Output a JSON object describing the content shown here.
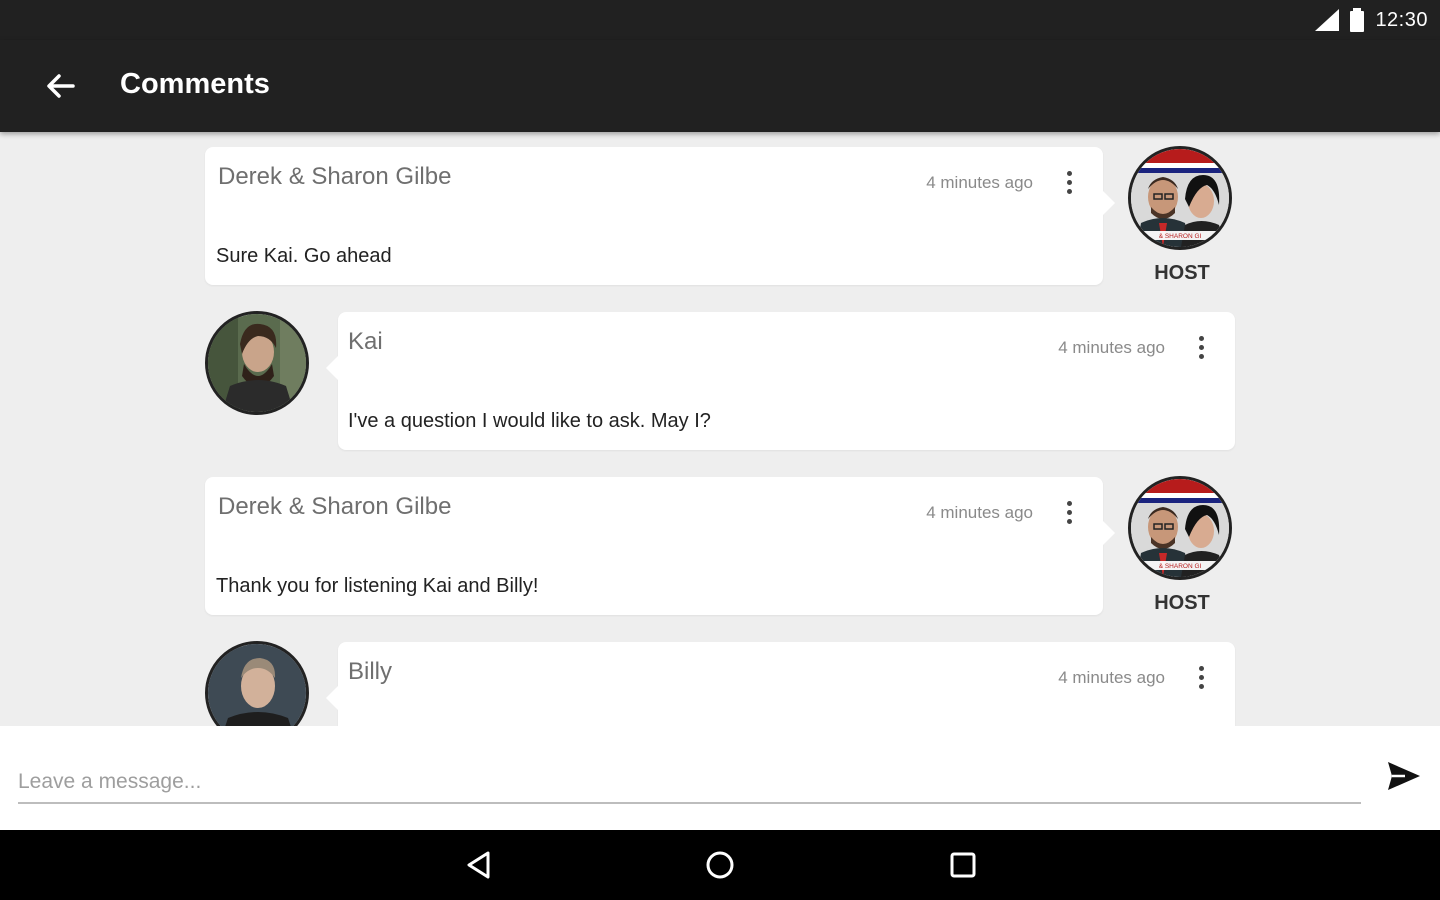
{
  "status_bar": {
    "time": "12:30",
    "icons": [
      "signal-icon",
      "battery-icon"
    ]
  },
  "app_bar": {
    "title": "Comments",
    "back_icon": "arrow-back-icon"
  },
  "comments": [
    {
      "author": "Derek & Sharon Gilbe",
      "time": "4 minutes ago",
      "message": "Sure Kai. Go ahead",
      "role": "HOST",
      "avatar_caption": "& SHARON GI"
    },
    {
      "author": "Kai",
      "time": "4 minutes ago",
      "message": "I've a question I would like to ask. May I?"
    },
    {
      "author": "Derek & Sharon Gilbe",
      "time": "4 minutes ago",
      "message": "Thank you for listening Kai and Billy!",
      "role": "HOST",
      "avatar_caption": "& SHARON GI"
    },
    {
      "author": "Billy",
      "time": "4 minutes ago",
      "message": ""
    }
  ],
  "composer": {
    "placeholder": "Leave a message...",
    "send_icon": "send-icon"
  },
  "nav_bar": {
    "icons": [
      "back-triangle-icon",
      "home-circle-icon",
      "recents-square-icon"
    ]
  },
  "colors": {
    "app_bar": "#212121",
    "background": "#eeeeee",
    "card": "#ffffff",
    "nav_bar": "#000000"
  }
}
